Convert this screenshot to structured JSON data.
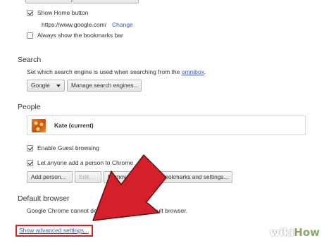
{
  "appearance": {
    "show_home_button": {
      "label": "Show Home button",
      "checked": true
    },
    "home_url": "https://www.google.com/",
    "change_link": "Change",
    "bookmarks_bar": {
      "label": "Always show the bookmarks bar",
      "checked": false
    }
  },
  "search": {
    "title": "Search",
    "description_prefix": "Set which search engine is used when searching from the ",
    "omnibox_link": "omnibox",
    "description_suffix": ".",
    "engine_select": "Google",
    "manage_button": "Manage search engines..."
  },
  "people": {
    "title": "People",
    "current_profile": "Kate (current)",
    "guest_browsing": {
      "label": "Enable Guest browsing",
      "checked": true
    },
    "add_person_to_chrome": {
      "label": "Let anyone add a person to Chrome",
      "checked": true
    },
    "buttons": {
      "add_person": "Add person...",
      "edit": "Edit...",
      "remove": "Remove...",
      "import": "Import bookmarks and settings..."
    }
  },
  "default_browser": {
    "title": "Default browser",
    "status_text": "Google Chrome cannot determine or set the default browser."
  },
  "footer": {
    "advanced_link": "Show advanced settings..."
  },
  "annotation": {
    "arrow_color": "#d3202a",
    "highlight_color": "#d3202a"
  },
  "watermark": {
    "wiki": "wiki",
    "how": "How"
  }
}
